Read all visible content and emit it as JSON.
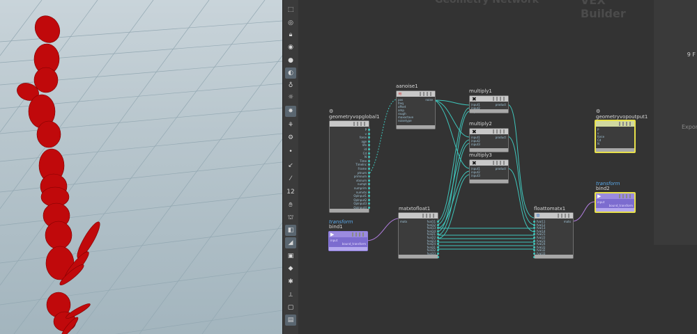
{
  "network": {
    "title_watermark": "VEX Builder",
    "title_left_partial": "Geometry Network"
  },
  "right_panel": {
    "text_top": "9 F",
    "text_mid": "Expor"
  },
  "shelf_tools": [
    "select-icon",
    "view-icon",
    "lock-icon",
    "camera-icon",
    "light-icon",
    "bulb-icon",
    "pin-icon",
    "pointlight-icon",
    "render-icon",
    "group-icon",
    "dot-icon",
    "knife-icon",
    "brush-icon",
    "number-icon",
    "hand-icon",
    "tag-icon",
    "box-icon",
    "box2-icon",
    "box3-icon",
    "diamond-icon",
    "bug-icon",
    "snap-icon",
    "display-icon",
    "render2-icon"
  ],
  "shelf_number": "12",
  "nodes": {
    "aanoise": {
      "name": "aanoise1",
      "inputs": [
        "pos",
        "freq",
        "offset",
        "amp",
        "rough",
        "maxoctave",
        "noisetype"
      ],
      "output": "noise"
    },
    "global": {
      "name": "geometryvopglobal1",
      "outputs": [
        "P",
        "v",
        "force",
        "age",
        "life",
        "id",
        "Cd",
        "N",
        "Time",
        "TimeInc",
        "Frame",
        "ptnum",
        "primnum",
        "vtxnum",
        "numpt",
        "numprim",
        "numvtx",
        "OpInput1",
        "OpInput2",
        "OpInput3",
        "OpInput4"
      ]
    },
    "multiply1": {
      "name": "multiply1",
      "inputs": [
        "input1",
        "input2",
        "input3"
      ],
      "output": "product"
    },
    "multiply2": {
      "name": "multiply2",
      "inputs": [
        "input1",
        "input2",
        "input3"
      ],
      "output": "product"
    },
    "multiply3": {
      "name": "multiply3",
      "inputs": [
        "input1",
        "input2",
        "input3"
      ],
      "output": "product"
    },
    "output": {
      "name": "geometryvopoutput1",
      "inputs": [
        "P",
        "v",
        "force",
        "Cd",
        "N"
      ]
    },
    "bind1": {
      "context": "transform",
      "name": "bind1",
      "port": "input",
      "output": "bound_transform"
    },
    "bind2": {
      "context": "transform",
      "name": "bind2",
      "port": "input",
      "output": "bound_transform"
    },
    "matx": {
      "name": "matxtofloat1",
      "input": "matx",
      "outputs": [
        "fval11",
        "fval12",
        "fval13",
        "fval14",
        "fval21",
        "fval22",
        "fval23",
        "fval24",
        "fval31",
        "fval32",
        "fval33",
        "fval34"
      ]
    },
    "floatto": {
      "name": "floattomatx1",
      "output": "matx",
      "inputs": [
        "fval11",
        "fval12",
        "fval13",
        "fval14",
        "fval21",
        "fval22",
        "fval23",
        "fval24",
        "fval31",
        "fval32",
        "fval33",
        "fval34"
      ]
    }
  },
  "colors": {
    "wire": "#3fc6bc",
    "wire_purple": "#b27ee0",
    "selection": "#e8e14a"
  }
}
